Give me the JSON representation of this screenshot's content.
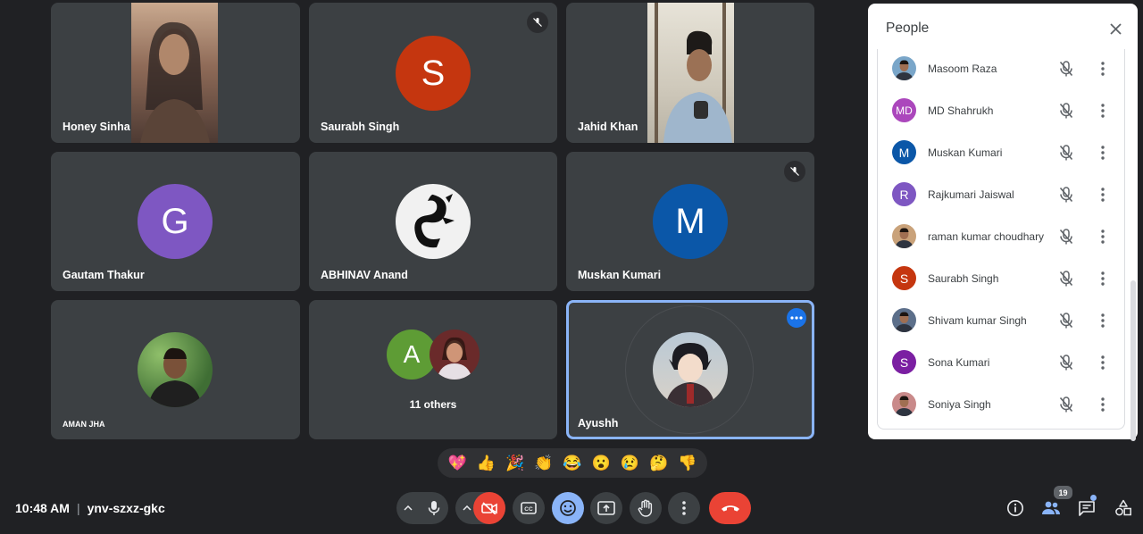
{
  "tiles": [
    {
      "name": "Honey Sinha",
      "type": "video"
    },
    {
      "name": "Saurabh Singh",
      "type": "avatar",
      "initial": "S",
      "color": "#c5360f",
      "muted": true
    },
    {
      "name": "Jahid Khan",
      "type": "video"
    },
    {
      "name": "Gautam Thakur",
      "type": "avatar",
      "initial": "G",
      "color": "#7e57c2"
    },
    {
      "name": "ABHINAV Anand",
      "type": "photo"
    },
    {
      "name": "Muskan Kumari",
      "type": "avatar",
      "initial": "M",
      "color": "#0b57a8",
      "muted": true
    },
    {
      "name": "AMAN JHA",
      "type": "photo"
    },
    {
      "name": "11 others",
      "type": "group",
      "initial": "A",
      "color": "#5e9c35"
    },
    {
      "name": "Ayushh",
      "type": "photo",
      "active": true
    }
  ],
  "reactions": [
    "💖",
    "👍",
    "🎉",
    "👏",
    "😂",
    "😮",
    "😢",
    "🤔",
    "👎"
  ],
  "meeting": {
    "time": "10:48 AM",
    "separator": "|",
    "code": "ynv-szxz-gkc"
  },
  "people_count": "19",
  "panel": {
    "title": "People",
    "people": [
      {
        "name": "Masoom Raza",
        "type": "photo",
        "color": "#7aa6c9"
      },
      {
        "name": "MD Shahrukh",
        "type": "initial",
        "initial": "MD",
        "color": "#ab47bc"
      },
      {
        "name": "Muskan Kumari",
        "type": "initial",
        "initial": "M",
        "color": "#0b57a8"
      },
      {
        "name": "Rajkumari Jaiswal",
        "type": "initial",
        "initial": "R",
        "color": "#7e57c2"
      },
      {
        "name": "raman kumar choudhary",
        "type": "photo",
        "color": "#c9a27a"
      },
      {
        "name": "Saurabh Singh",
        "type": "initial",
        "initial": "S",
        "color": "#c5360f"
      },
      {
        "name": "Shivam kumar Singh",
        "type": "photo",
        "color": "#5c6f8a"
      },
      {
        "name": "Sona Kumari",
        "type": "initial",
        "initial": "S",
        "color": "#7b1fa2"
      },
      {
        "name": "Soniya Singh",
        "type": "photo",
        "color": "#c98a8a"
      }
    ]
  },
  "colors": {
    "background": "#202124",
    "tile": "#3c4043",
    "active_border": "#8ab4f8",
    "hangup": "#ea4335",
    "accent_blue": "#1a73e8"
  }
}
